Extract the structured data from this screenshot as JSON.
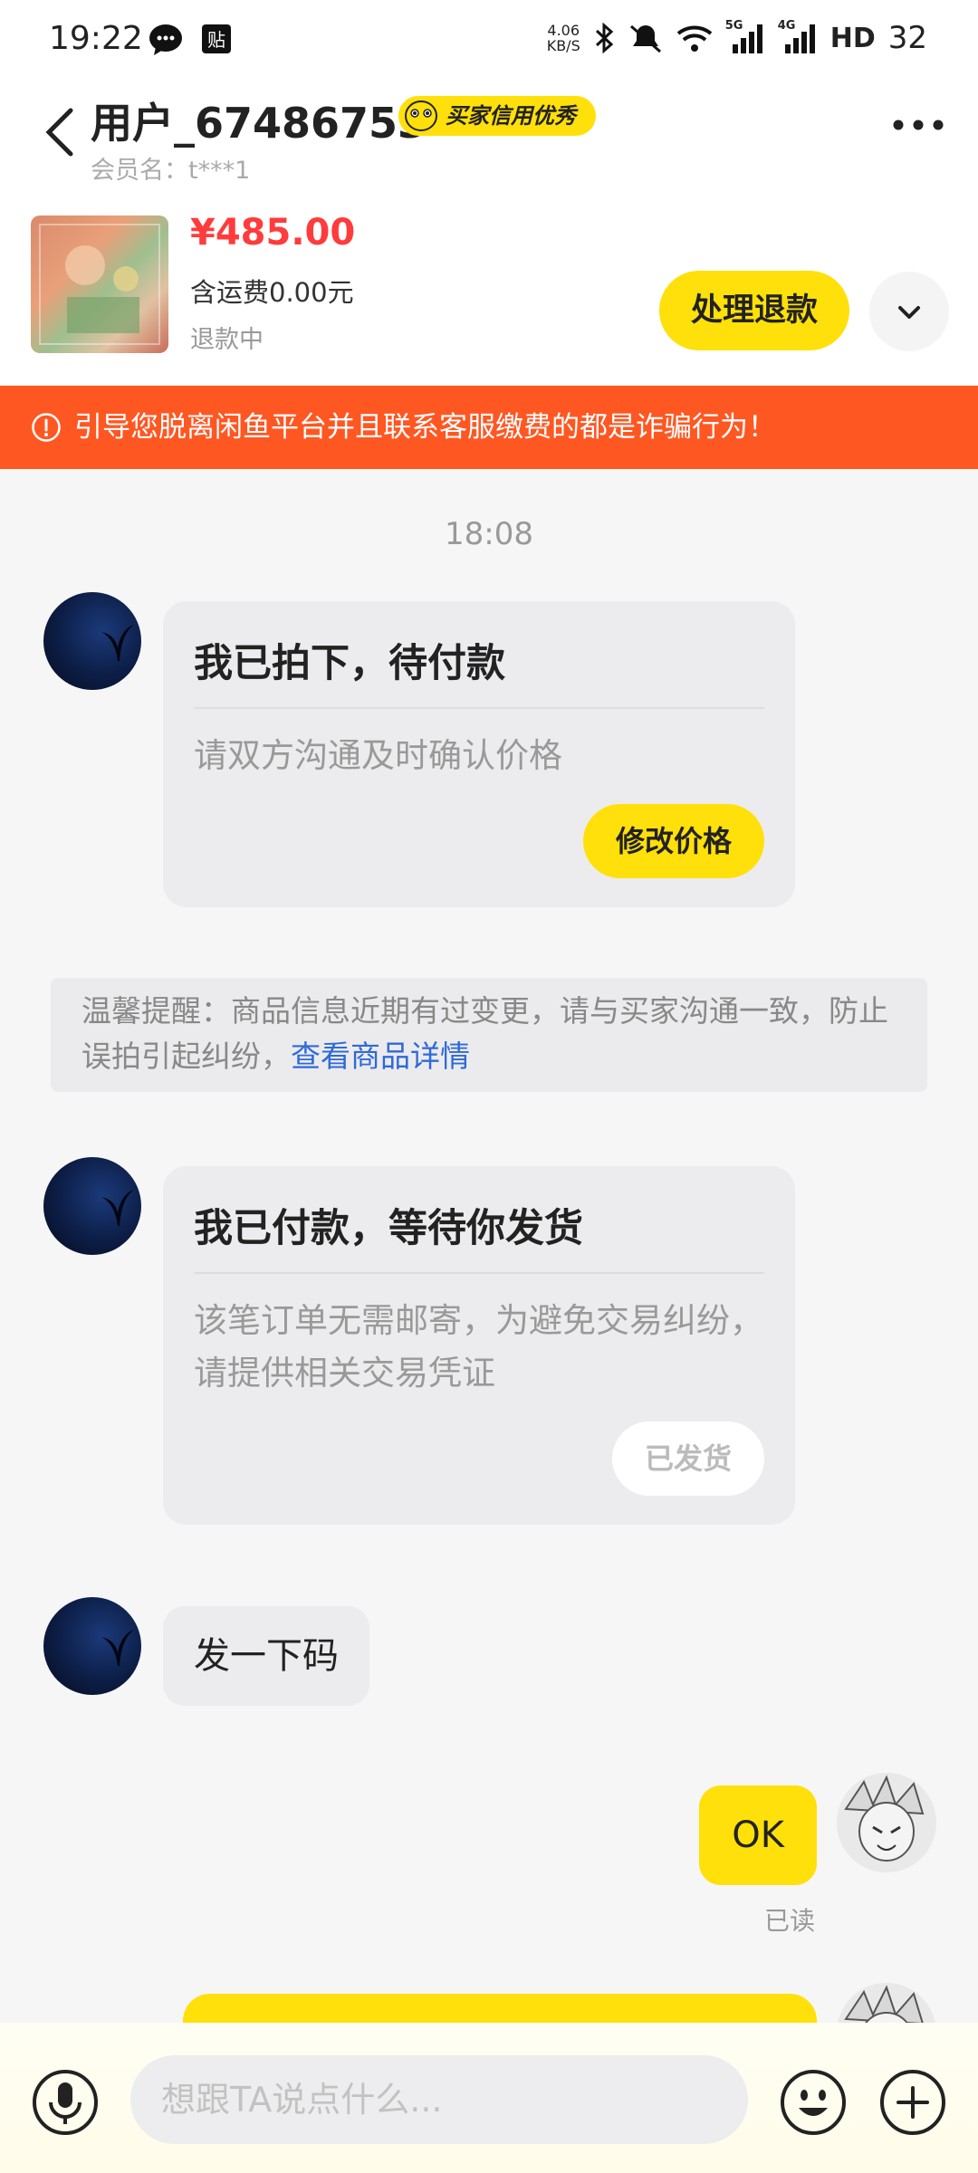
{
  "status_bar": {
    "time": "19:22",
    "net_speed_top": "4.06",
    "net_speed_bottom": "KB/S",
    "battery": "32",
    "hd_label": "HD",
    "sig1": "5G",
    "sig2": "4G",
    "icons": [
      "chat-app-icon",
      "sticker-icon",
      "bluetooth-icon",
      "mute-icon",
      "wifi-icon",
      "signal-5g-icon",
      "signal-4g-icon",
      "hd-icon"
    ]
  },
  "header": {
    "username": "用户_67486753",
    "badge": "买家信用优秀",
    "member_name": "会员名：t***1"
  },
  "order": {
    "price": "¥485.00",
    "shipping": "含运费0.00元",
    "status": "退款中",
    "refund_button": "处理退款"
  },
  "warning": {
    "text": "引导您脱离闲鱼平台并且联系客服缴费的都是诈骗行为！"
  },
  "chat": {
    "timestamp": "18:08",
    "card1": {
      "title": "我已拍下，待付款",
      "subtitle": "请双方沟通及时确认价格",
      "button": "修改价格"
    },
    "notice": {
      "text": "温馨提醒：商品信息近期有过变更，请与买家沟通一致，防止误拍引起纠纷，",
      "link": "查看商品详情"
    },
    "card2": {
      "title": "我已付款，等待你发货",
      "subtitle": "该笔订单无需邮寄，为避免交易纠纷，请提供相关交易凭证",
      "button": "已发货"
    },
    "message_left": "发一下码",
    "message_right": "OK",
    "read_status": "已读"
  },
  "input_bar": {
    "placeholder": "想跟TA说点什么..."
  },
  "colors": {
    "accent_yellow": "#ffe00a",
    "price_red": "#ff3b3b",
    "warning_orange": "#ff5722",
    "link_blue": "#2f6ad6"
  }
}
